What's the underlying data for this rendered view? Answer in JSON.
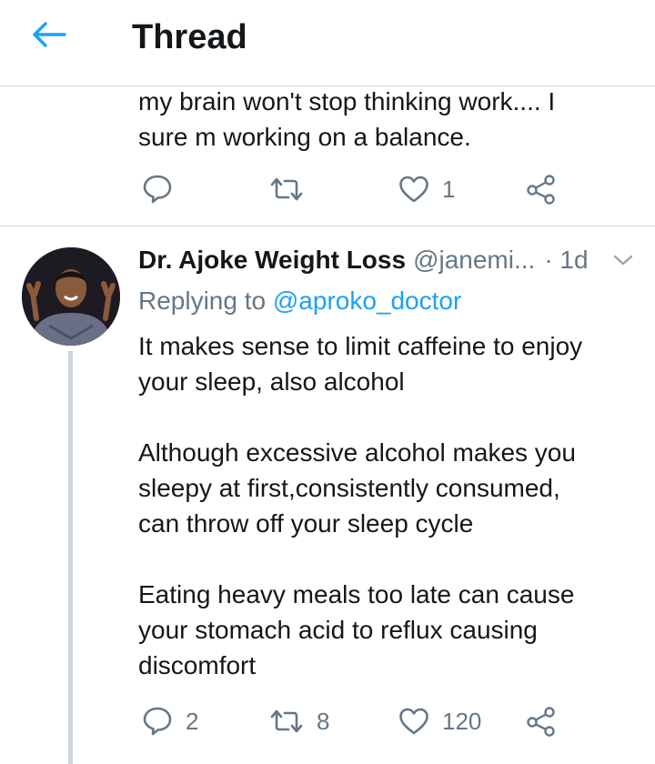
{
  "header": {
    "title": "Thread"
  },
  "colors": {
    "accent": "#1da1f2",
    "muted": "#657786",
    "text": "#14171a",
    "divider": "#d4d9dd"
  },
  "previous_tweet": {
    "text": "my brain won't stop thinking work.... I\nsure m working on a balance.",
    "actions": {
      "reply_count": "",
      "retweet_count": "",
      "like_count": "1"
    }
  },
  "reply_tweet": {
    "display_name": "Dr. Ajoke Weight Loss",
    "handle": "@janemi...",
    "time": "· 1d",
    "replying_prefix": "Replying to ",
    "replying_to": "@aproko_doctor",
    "text": "It makes sense to limit caffeine to enjoy\nyour sleep, also alcohol\n\nAlthough excessive alcohol makes you\nsleepy at first,consistently consumed,\ncan throw off your sleep cycle\n\nEating heavy meals too late can cause\nyour stomach acid to reflux causing\ndiscomfort",
    "actions": {
      "reply_count": "2",
      "retweet_count": "8",
      "like_count": "120"
    }
  },
  "icons": {
    "back": "arrow-left-icon",
    "reply": "speech-bubble-icon",
    "retweet": "retweet-arrows-icon",
    "like": "heart-icon",
    "share": "share-nodes-icon",
    "more": "chevron-down-icon"
  }
}
